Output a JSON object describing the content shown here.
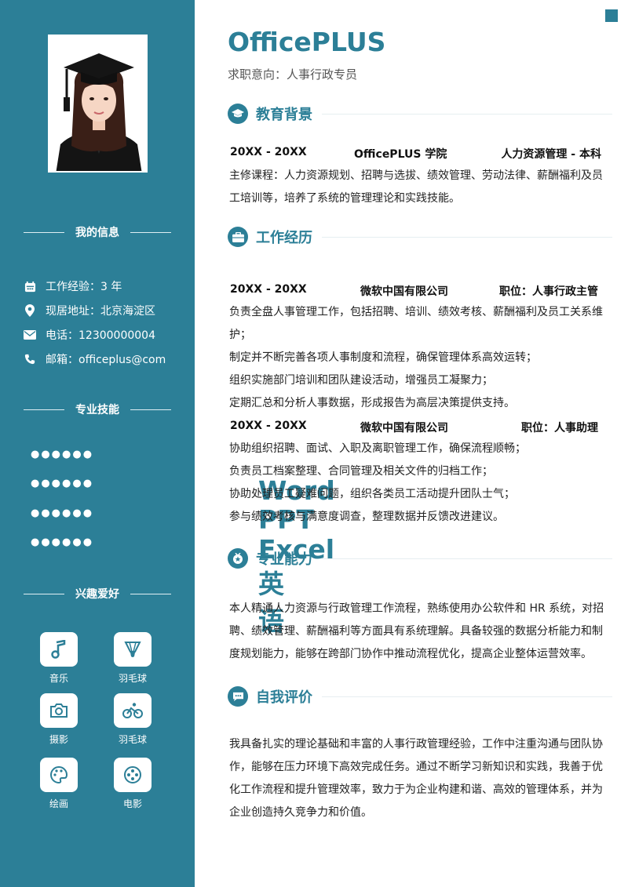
{
  "header": {
    "name": "OfficePLUS",
    "intent": "求职意向：人事行政专员"
  },
  "sidebar": {
    "info_title": "我的信息",
    "info": [
      {
        "icon": "calendar-icon",
        "text": "工作经验：3 年"
      },
      {
        "icon": "location-icon",
        "text": "现居地址：北京海淀区"
      },
      {
        "icon": "envelope-icon",
        "text": "电话：12300000004"
      },
      {
        "icon": "phone-icon",
        "text": "邮箱：officeplus@com"
      }
    ],
    "skills_title": "专业技能",
    "skills": [
      {
        "name": "Word",
        "dots": "●●●●●●"
      },
      {
        "name": "PPT",
        "dots": "●●●●●●"
      },
      {
        "name": "Excel",
        "dots": "●●●●●●"
      },
      {
        "name": "英语",
        "dots": "●●●●●●"
      }
    ],
    "hobbies_title": "兴趣爱好",
    "hobbies": [
      {
        "icon": "music-note-icon",
        "label": "音乐"
      },
      {
        "icon": "shuttlecock-icon",
        "label": "羽毛球"
      },
      {
        "icon": "camera-icon",
        "label": "摄影"
      },
      {
        "icon": "bicycle-icon",
        "label": "羽毛球"
      },
      {
        "icon": "palette-icon",
        "label": "绘画"
      },
      {
        "icon": "film-reel-icon",
        "label": "电影"
      }
    ]
  },
  "education": {
    "title": "教育背景",
    "period": "20XX - 20XX",
    "school": "OfficePLUS 学院",
    "major": "人力资源管理 - 本科",
    "desc": "主修课程：人力资源规划、招聘与选拔、绩效管理、劳动法律、薪酬福利及员工培训等，培养了系统的管理理论和实践技能。"
  },
  "work": {
    "title": "工作经历",
    "jobs": [
      {
        "period": "20XX - 20XX",
        "company": "微软中国有限公司",
        "position": "职位：人事行政主管",
        "duties": "负责全盘人事管理工作，包括招聘、培训、绩效考核、薪酬福利及员工关系维护；\n制定并不断完善各项人事制度和流程，确保管理体系高效运转；\n组织实施部门培训和团队建设活动，增强员工凝聚力；\n定期汇总和分析人事数据，形成报告为高层决策提供支持。"
      },
      {
        "period": "20XX - 20XX",
        "company": "微软中国有限公司",
        "position": "职位：人事助理",
        "duties": "协助组织招聘、面试、入职及离职管理工作，确保流程顺畅；\n负责员工档案整理、合同管理及相关文件的归档工作；\n协助处理员工疑难问题，组织各类员工活动提升团队士气；\n参与绩效考核与满意度调查，整理数据并反馈改进建议。"
      }
    ]
  },
  "ability": {
    "title": "专业能力",
    "text": "本人精通人力资源与行政管理工作流程，熟练使用办公软件和 HR 系统，对招聘、绩效管理、薪酬福利等方面具有系统理解。具备较强的数据分析能力和制度规划能力，能够在跨部门协作中推动流程优化，提高企业整体运营效率。"
  },
  "evaluation": {
    "title": "自我评价",
    "text": "我具备扎实的理论基础和丰富的人事行政管理经验，工作中注重沟通与团队协作，能够在压力环境下高效完成任务。通过不断学习新知识和实践，我善于优化工作流程和提升管理效率，致力于为企业构建和谐、高效的管理体系，并为企业创造持久竞争力和价值。"
  }
}
